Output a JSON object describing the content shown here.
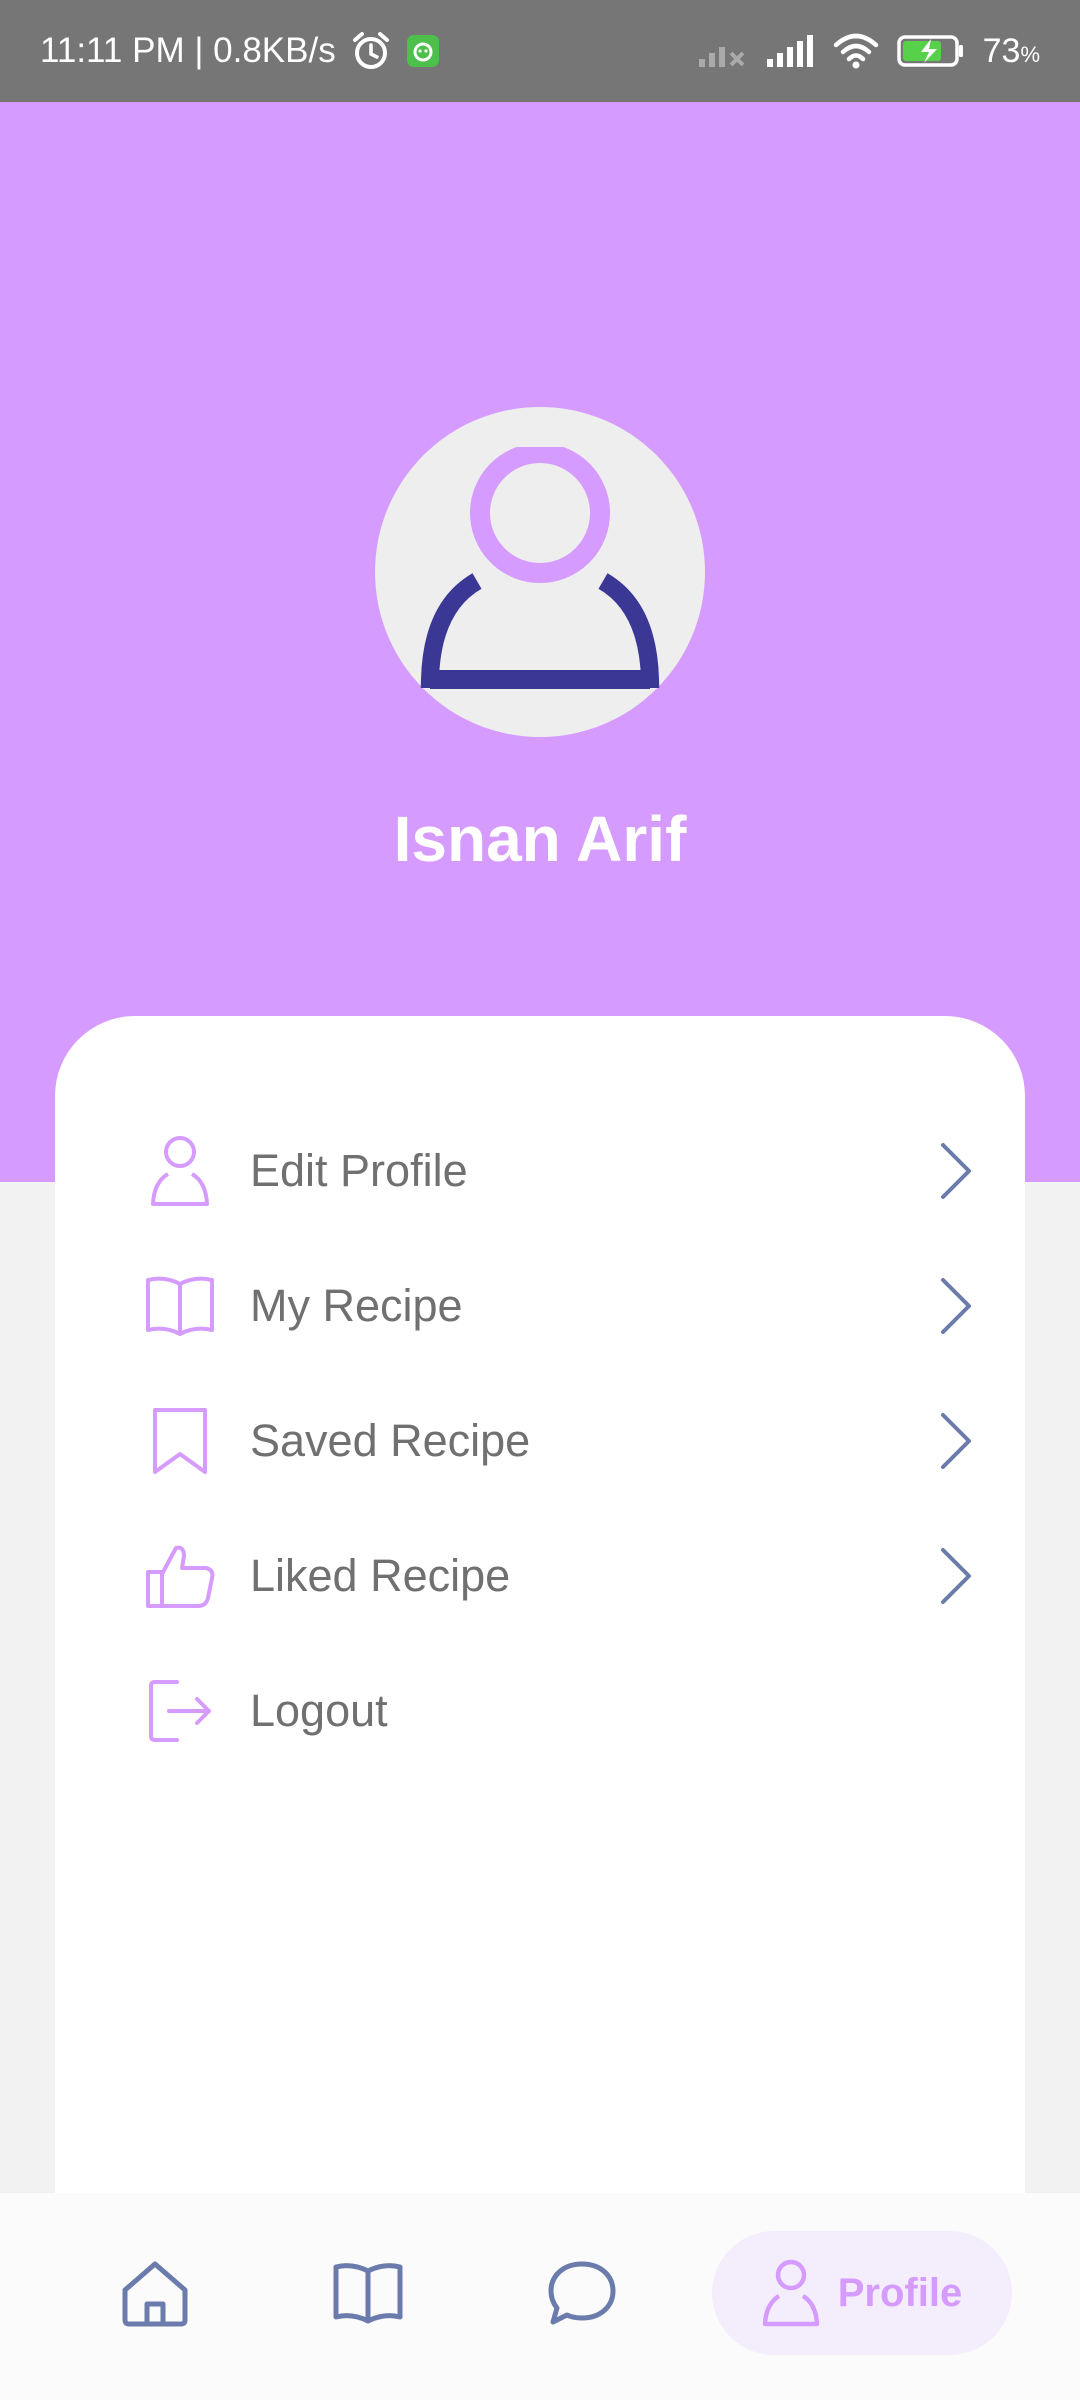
{
  "status_bar": {
    "time_speed": "11:11 PM | 0.8KB/s",
    "battery": "73",
    "battery_unit": "%"
  },
  "profile": {
    "name": "Isnan Arif"
  },
  "menu": {
    "items": [
      {
        "label": "Edit Profile",
        "icon": "user-icon"
      },
      {
        "label": "My Recipe",
        "icon": "book-icon"
      },
      {
        "label": "Saved Recipe",
        "icon": "bookmark-icon"
      },
      {
        "label": "Liked Recipe",
        "icon": "thumbs-up-icon"
      },
      {
        "label": "Logout",
        "icon": "logout-icon"
      }
    ]
  },
  "bottom_nav": {
    "items": [
      {
        "icon": "home-icon"
      },
      {
        "icon": "book-icon"
      },
      {
        "icon": "chat-icon"
      },
      {
        "icon": "user-icon",
        "label": "Profile",
        "active": true
      }
    ]
  },
  "colors": {
    "accent": "#d59bff",
    "dark_accent": "#3b3795",
    "nav_icon": "#6b7bab",
    "text": "#707070"
  }
}
